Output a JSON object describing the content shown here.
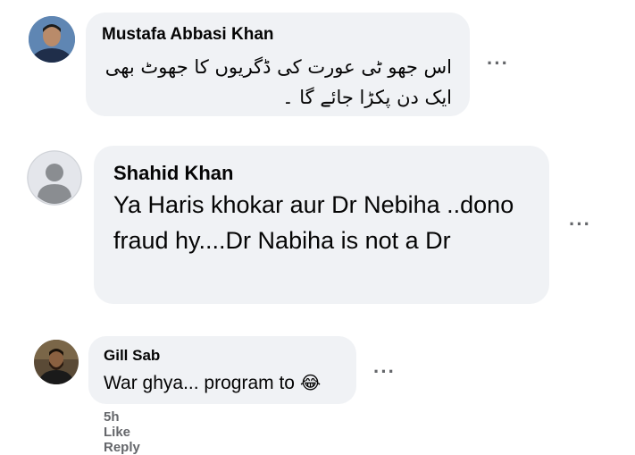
{
  "comments": [
    {
      "author": "Mustafa Abbasi Khan",
      "text": "اس جھو ٹی عورت کی ڈگریوں کا جھوٹ بھی ایک دن پکڑا جائے گا ۔",
      "avatar": "avatar-photo"
    },
    {
      "author": "Shahid Khan",
      "text": "Ya Haris khokar aur Dr Nebiha ..dono fraud hy....Dr Nabiha is not a Dr",
      "avatar": "default-avatar"
    },
    {
      "author": "Gill Sab",
      "text": "War ghya... program to",
      "emoji": "😂",
      "avatar": "avatar-photo",
      "meta": {
        "time": "5h",
        "like": "Like",
        "reply": "Reply"
      }
    }
  ],
  "more_glyph": "···",
  "colors": {
    "bubble": "#f0f2f5",
    "secondary": "#65676b",
    "text": "#050505"
  }
}
